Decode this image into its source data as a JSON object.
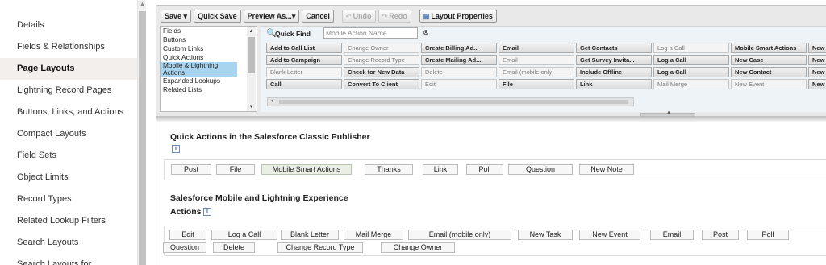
{
  "sidebar": {
    "items": [
      {
        "label": "Details",
        "active": false
      },
      {
        "label": "Fields & Relationships",
        "active": false
      },
      {
        "label": "Page Layouts",
        "active": true
      },
      {
        "label": "Lightning Record Pages",
        "active": false
      },
      {
        "label": "Buttons, Links, and Actions",
        "active": false
      },
      {
        "label": "Compact Layouts",
        "active": false
      },
      {
        "label": "Field Sets",
        "active": false
      },
      {
        "label": "Object Limits",
        "active": false
      },
      {
        "label": "Record Types",
        "active": false
      },
      {
        "label": "Related Lookup Filters",
        "active": false
      },
      {
        "label": "Search Layouts",
        "active": false
      },
      {
        "label": "Search Layouts for ...",
        "active": false
      }
    ]
  },
  "toolbar": {
    "save": "Save",
    "quick_save": "Quick Save",
    "preview_as": "Preview As...",
    "cancel": "Cancel",
    "undo": "Undo",
    "redo": "Redo",
    "layout_properties": "Layout Properties"
  },
  "categories": {
    "items": [
      "Fields",
      "Buttons",
      "Custom Links",
      "Quick Actions",
      "Mobile & Lightning Actions",
      "Expanded Lookups",
      "Related Lists"
    ],
    "selected": "Mobile & Lightning Actions"
  },
  "quick_find": {
    "label": "Quick Find",
    "placeholder": "Mobile Action Name"
  },
  "palette": {
    "rows": [
      [
        {
          "label": "Add to Call List",
          "state": "avail"
        },
        {
          "label": "Change Owner",
          "state": "used"
        },
        {
          "label": "Create Billing Ad...",
          "state": "avail"
        },
        {
          "label": "Email",
          "state": "avail"
        },
        {
          "label": "Get Contacts",
          "state": "avail"
        },
        {
          "label": "Log a Call",
          "state": "used"
        },
        {
          "label": "Mobile Smart Actions",
          "state": "avail"
        },
        {
          "label": "New Account",
          "state": "avail"
        }
      ],
      [
        {
          "label": "Add to Campaign",
          "state": "avail"
        },
        {
          "label": "Change Record Type",
          "state": "used"
        },
        {
          "label": "Create Mailing Ad...",
          "state": "avail"
        },
        {
          "label": "Email",
          "state": "used"
        },
        {
          "label": "Get Survey Invita...",
          "state": "avail"
        },
        {
          "label": "Log a Call",
          "state": "avail"
        },
        {
          "label": "New Case",
          "state": "avail"
        },
        {
          "label": "New Opportunity",
          "state": "avail"
        }
      ],
      [
        {
          "label": "Blank Letter",
          "state": "used"
        },
        {
          "label": "Check for New Data",
          "state": "avail"
        },
        {
          "label": "Delete",
          "state": "used"
        },
        {
          "label": "Email (mobile only)",
          "state": "used"
        },
        {
          "label": "Include Offline",
          "state": "avail"
        },
        {
          "label": "Log a Call",
          "state": "avail"
        },
        {
          "label": "New Contact",
          "state": "avail"
        },
        {
          "label": "New Task",
          "state": "avail"
        }
      ],
      [
        {
          "label": "Call",
          "state": "avail"
        },
        {
          "label": "Convert To Client",
          "state": "avail"
        },
        {
          "label": "Edit",
          "state": "used"
        },
        {
          "label": "File",
          "state": "avail"
        },
        {
          "label": "Link",
          "state": "avail"
        },
        {
          "label": "Mail Merge",
          "state": "used"
        },
        {
          "label": "New Event",
          "state": "used"
        },
        {
          "label": "New Note",
          "state": "avail"
        }
      ]
    ]
  },
  "classic_publisher": {
    "title": "Quick Actions in the Salesforce Classic Publisher",
    "info": "i",
    "actions": [
      "Post",
      "File",
      "Mobile Smart Actions",
      "Thanks",
      "Link",
      "Poll",
      "Question",
      "New Note"
    ]
  },
  "lightning_actions": {
    "title_line1": "Salesforce Mobile and Lightning Experience",
    "title_line2": "Actions",
    "info": "i",
    "row1": [
      "Edit",
      "Log a Call",
      "Blank Letter",
      "Mail Merge",
      "Email (mobile only)",
      "New Task",
      "New Event",
      "Email",
      "Post",
      "Poll"
    ],
    "row2": [
      "Question",
      "Delete",
      "Change Record Type",
      "Change Owner"
    ]
  }
}
